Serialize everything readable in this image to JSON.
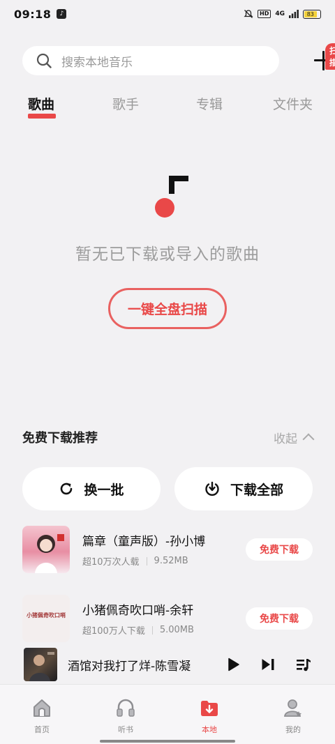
{
  "status_bar": {
    "time": "09:18",
    "network": "4G",
    "hd": "HD",
    "battery": "83"
  },
  "search": {
    "placeholder": "搜索本地音乐",
    "scan_badge": "扫描"
  },
  "tabs": [
    {
      "label": "歌曲",
      "active": true
    },
    {
      "label": "歌手",
      "active": false
    },
    {
      "label": "专辑",
      "active": false
    },
    {
      "label": "文件夹",
      "active": false
    }
  ],
  "empty_state": {
    "message": "暂无已下载或导入的歌曲",
    "scan_button": "一键全盘扫描"
  },
  "recommend": {
    "title": "免费下载推荐",
    "collapse_label": "收起",
    "refresh_label": "换一批",
    "download_all_label": "下载全部",
    "songs": [
      {
        "title": "篇章（童声版）-孙小博",
        "plays": "超10万次人载",
        "size": "9.52MB",
        "button": "免费下载"
      },
      {
        "title": "小猪佩奇吹口哨-余轩",
        "plays": "超100万人下载",
        "size": "5.00MB",
        "button": "免费下载",
        "cover_text": "小猪佩奇吹口哨"
      }
    ]
  },
  "mini_player": {
    "title": "酒馆对我打了烊-陈雪凝"
  },
  "nav": [
    {
      "label": "首页",
      "icon": "home-icon",
      "active": false
    },
    {
      "label": "听书",
      "icon": "headphones-icon",
      "active": false
    },
    {
      "label": "本地",
      "icon": "download-folder-icon",
      "active": true
    },
    {
      "label": "我的",
      "icon": "profile-icon",
      "active": false
    }
  ],
  "colors": {
    "accent": "#e94848",
    "background": "#f2f1f3"
  }
}
